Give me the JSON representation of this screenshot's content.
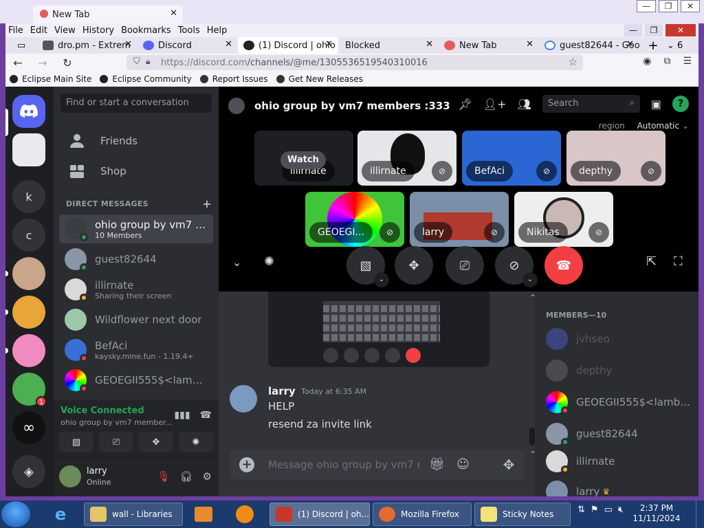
{
  "outer": {
    "tab_title": "New Tab"
  },
  "menubar": [
    "File",
    "Edit",
    "View",
    "History",
    "Bookmarks",
    "Tools",
    "Help"
  ],
  "tabs": [
    {
      "title": "dro.pm - Extrem",
      "icon": "page-icon",
      "color": "#555555"
    },
    {
      "title": "Discord",
      "icon": "discord-icon",
      "color": "#5865f2"
    },
    {
      "title": "(1) Discord | ohio",
      "icon": "discord-icon",
      "color": "#222222"
    },
    {
      "title": "Blocked",
      "icon": "",
      "color": ""
    },
    {
      "title": "New Tab",
      "icon": "firefox-icon",
      "color": "#e35d5b"
    },
    {
      "title": "guest82644 - Goo",
      "icon": "google-icon",
      "color": "#4285f4"
    }
  ],
  "tab_count": "6",
  "url": {
    "host": "https://discord.com",
    "path": "/channels/@me/1305536519540310016"
  },
  "bookmarks": [
    "Eclipse Main Site",
    "Eclipse Community",
    "Report Issues",
    "Get New Releases"
  ],
  "guilds": [
    {
      "label": "",
      "type": "home"
    },
    {
      "label": "",
      "type": "image"
    },
    {
      "label": "k",
      "type": "letter"
    },
    {
      "label": "c",
      "type": "letter"
    },
    {
      "label": "",
      "type": "image"
    },
    {
      "label": "",
      "type": "image"
    },
    {
      "label": "",
      "type": "image"
    },
    {
      "label": "",
      "type": "image",
      "badge": "1"
    },
    {
      "label": "",
      "type": "image"
    },
    {
      "label": "",
      "type": "explore"
    }
  ],
  "dm": {
    "search_placeholder": "Find or start a conversation",
    "friends": "Friends",
    "shop": "Shop",
    "header": "DIRECT MESSAGES",
    "items": [
      {
        "name": "ohio group by vm7 me...",
        "sub": "10 Members",
        "active": true,
        "status": "#23a55a",
        "color": "#3b3d44"
      },
      {
        "name": "guest82644",
        "sub": "",
        "active": false,
        "status": "#23a55a",
        "color": "#8a95a6"
      },
      {
        "name": "illirnate",
        "sub": "Sharing their screen",
        "active": false,
        "status": "#f0b232",
        "color": "#d9d9d9"
      },
      {
        "name": "Wildflower next door",
        "sub": "",
        "active": false,
        "status": "",
        "color": "#9cc7a8"
      },
      {
        "name": "BefAci",
        "sub": "kaysky.mine.fun - 1.19.4+",
        "active": false,
        "status": "#f23f43",
        "color": "#3a6fd8"
      },
      {
        "name": "GEOEGII555$<lambd...",
        "sub": "",
        "active": false,
        "status": "#f23f43",
        "color": "#c44"
      }
    ]
  },
  "voice": {
    "title": "Voice Connected",
    "sub": "ohio group by vm7 member..."
  },
  "user": {
    "name": "larry",
    "status": "Online"
  },
  "call": {
    "title": "ohio group by vm7 members :333",
    "search_placeholder": "Search",
    "region_label": "region",
    "region_value": "Automatic",
    "watch": "Watch",
    "tiles": [
      {
        "name": "illirnate",
        "color": "#2b2d31"
      },
      {
        "name": "illirnate",
        "color": "#e6e6ea"
      },
      {
        "name": "BefAci",
        "color": "#2a66d4"
      },
      {
        "name": "depthy",
        "color": "#d8c6c8"
      },
      {
        "name": "GEOEGI...",
        "color": "#3fc43a"
      },
      {
        "name": "larry",
        "color": "#7b8fa8"
      },
      {
        "name": "Nikitas",
        "color": "#eeeeee"
      }
    ]
  },
  "chat": {
    "author": "larry",
    "time": "Today at 6:35 AM",
    "line1": "HELP",
    "line2": "resend za invite link",
    "placeholder": "Message ohio group by vm7 m..."
  },
  "members": {
    "header": "MEMBERS—10",
    "list": [
      {
        "name": "jvhseo",
        "offline": true,
        "status": "",
        "color": "#5865f2"
      },
      {
        "name": "depthy",
        "offline": true,
        "status": "",
        "color": "#777777"
      },
      {
        "name": "GEOEGII555$<lambd...",
        "offline": false,
        "status": "#f23f43",
        "color": "#c44"
      },
      {
        "name": "guest82644",
        "offline": false,
        "status": "#23a55a",
        "color": "#8a95a6"
      },
      {
        "name": "illirnate",
        "offline": false,
        "status": "#f0b232",
        "color": "#d9d9d9"
      },
      {
        "name": "larry",
        "offline": false,
        "status": "",
        "color": "#7b8fa8",
        "crown": true
      }
    ]
  },
  "taskbar": {
    "apps": [
      {
        "label": "wall - Libraries",
        "color": "#e6c46a",
        "active": false
      },
      {
        "label": "(1) Discord | oh...",
        "color": "#c8372d",
        "active": true
      },
      {
        "label": "Mozilla Firefox",
        "color": "#e56a2e",
        "active": false
      },
      {
        "label": "Sticky Notes",
        "color": "#f2e27a",
        "active": false
      }
    ],
    "time": "2:37 PM",
    "date": "11/11/2024"
  }
}
